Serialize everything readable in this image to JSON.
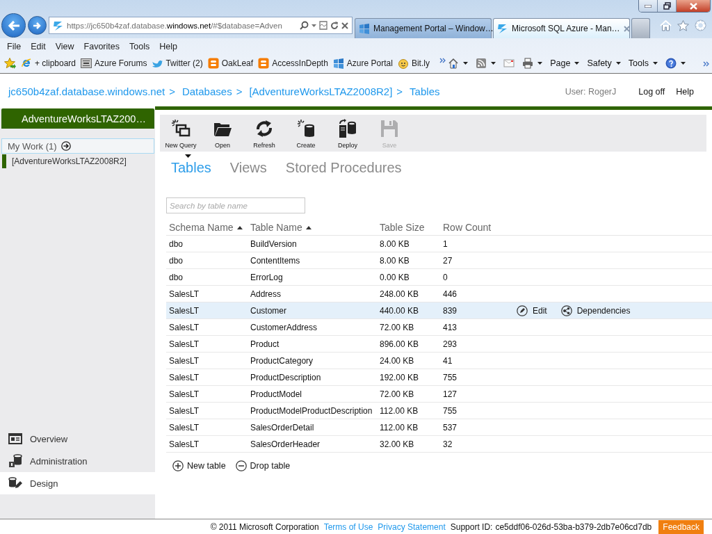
{
  "browser": {
    "address": "https://jc650b4zaf.database.**windows.net**/#$database=Adven",
    "tabs": [
      {
        "label": "Management Portal – Window…",
        "kind": "windows",
        "selected": false
      },
      {
        "label": "Microsoft SQL Azure - Man…",
        "kind": "azure",
        "selected": true
      }
    ],
    "menu": [
      "File",
      "Edit",
      "View",
      "Favorites",
      "Tools",
      "Help"
    ],
    "favorites": [
      {
        "label": "+ clipboard",
        "kind": "ie"
      },
      {
        "label": "Azure Forums",
        "kind": "tn"
      },
      {
        "label": "Twitter (2)",
        "kind": "bird"
      },
      {
        "label": "OakLeaf",
        "kind": "blogger"
      },
      {
        "label": "AccessInDepth",
        "kind": "blogger"
      },
      {
        "label": "Azure Portal",
        "kind": "windows"
      },
      {
        "label": "Bit.ly",
        "kind": "face"
      }
    ],
    "commands": [
      {
        "kind": "home",
        "dropdown": true
      },
      {
        "kind": "feeds",
        "dropdown": true
      },
      {
        "kind": "mail",
        "dropdown": false
      },
      {
        "kind": "print",
        "dropdown": true
      },
      {
        "kind": "menu",
        "label": "Page",
        "dropdown": true
      },
      {
        "kind": "menu",
        "label": "Safety",
        "dropdown": true
      },
      {
        "kind": "menu",
        "label": "Tools",
        "dropdown": true
      },
      {
        "kind": "help",
        "dropdown": true
      }
    ]
  },
  "header": {
    "breadcrumb": [
      {
        "label": "jc650b4zaf.database.windows.net",
        "separator": ">"
      },
      {
        "label": "Databases",
        "separator": ">"
      },
      {
        "label": "[AdventureWorksLTAZ2008R2]",
        "separator": ">"
      },
      {
        "label": "Tables"
      }
    ],
    "user": "User: RogerJ",
    "links": [
      "Log off",
      "Help"
    ]
  },
  "sidebar": {
    "title": "AdventureWorksLTAZ200…",
    "my_work": "My Work (1)",
    "items": [
      {
        "label": "[AdventureWorksLTAZ2008R2]",
        "selected": true
      }
    ],
    "nav": [
      {
        "label": "Overview",
        "kind": "overview",
        "selected": false
      },
      {
        "label": "Administration",
        "kind": "administration",
        "selected": false
      },
      {
        "label": "Design",
        "kind": "design",
        "selected": true
      }
    ]
  },
  "toolbar": [
    {
      "label": "New Query",
      "kind": "query",
      "disabled": false,
      "dropdown": true
    },
    {
      "label": "Open",
      "kind": "open",
      "disabled": false,
      "dropdown": false
    },
    {
      "label": "Refresh",
      "kind": "refresh",
      "disabled": false,
      "dropdown": false
    },
    {
      "label": "Create",
      "kind": "create",
      "disabled": false,
      "dropdown": false
    },
    {
      "label": "Deploy",
      "kind": "deploy",
      "disabled": false,
      "dropdown": false
    },
    {
      "label": "Save",
      "kind": "save",
      "disabled": true,
      "dropdown": false
    }
  ],
  "tabs": [
    {
      "label": "Tables",
      "selected": true
    },
    {
      "label": "Views",
      "selected": false
    },
    {
      "label": "Stored Procedures",
      "selected": false
    }
  ],
  "search": {
    "placeholder": "Search by table name"
  },
  "table": {
    "columns": [
      {
        "label": "Schema Name",
        "sorted": true
      },
      {
        "label": "Table Name",
        "sorted": true
      },
      {
        "label": "Table Size",
        "sorted": false
      },
      {
        "label": "Row Count",
        "sorted": false
      }
    ],
    "rows": [
      {
        "cells": [
          "dbo",
          "BuildVersion",
          "8.00 KB",
          "1"
        ],
        "selected": false
      },
      {
        "cells": [
          "dbo",
          "ContentItems",
          "8.00 KB",
          "27"
        ],
        "selected": false
      },
      {
        "cells": [
          "dbo",
          "ErrorLog",
          "0.00 KB",
          "0"
        ],
        "selected": false
      },
      {
        "cells": [
          "SalesLT",
          "Address",
          "248.00 KB",
          "446"
        ],
        "selected": false
      },
      {
        "cells": [
          "SalesLT",
          "Customer",
          "440.00 KB",
          "839"
        ],
        "selected": true
      },
      {
        "cells": [
          "SalesLT",
          "CustomerAddress",
          "72.00 KB",
          "413"
        ],
        "selected": false
      },
      {
        "cells": [
          "SalesLT",
          "Product",
          "896.00 KB",
          "293"
        ],
        "selected": false
      },
      {
        "cells": [
          "SalesLT",
          "ProductCategory",
          "24.00 KB",
          "41"
        ],
        "selected": false
      },
      {
        "cells": [
          "SalesLT",
          "ProductDescription",
          "192.00 KB",
          "755"
        ],
        "selected": false
      },
      {
        "cells": [
          "SalesLT",
          "ProductModel",
          "72.00 KB",
          "127"
        ],
        "selected": false
      },
      {
        "cells": [
          "SalesLT",
          "ProductModelProductDescription",
          "112.00 KB",
          "755"
        ],
        "selected": false
      },
      {
        "cells": [
          "SalesLT",
          "SalesOrderDetail",
          "112.00 KB",
          "537"
        ],
        "selected": false
      },
      {
        "cells": [
          "SalesLT",
          "SalesOrderHeader",
          "32.00 KB",
          "32"
        ],
        "selected": false
      }
    ],
    "row_actions": [
      {
        "label": "Edit",
        "kind": "edit"
      },
      {
        "label": "Dependencies",
        "kind": "dependencies"
      }
    ]
  },
  "table_actions": [
    {
      "label": "New table",
      "kind": "add"
    },
    {
      "label": "Drop table",
      "kind": "remove"
    }
  ],
  "footer": {
    "copyright": "© 2011 Microsoft Corporation",
    "links": [
      "Terms of Use",
      "Privacy Statement"
    ],
    "support_label": "Support ID:",
    "support_id": "ce5ddf06-026d-53ba-b379-2db7e06cd7db",
    "feedback": "Feedback"
  }
}
